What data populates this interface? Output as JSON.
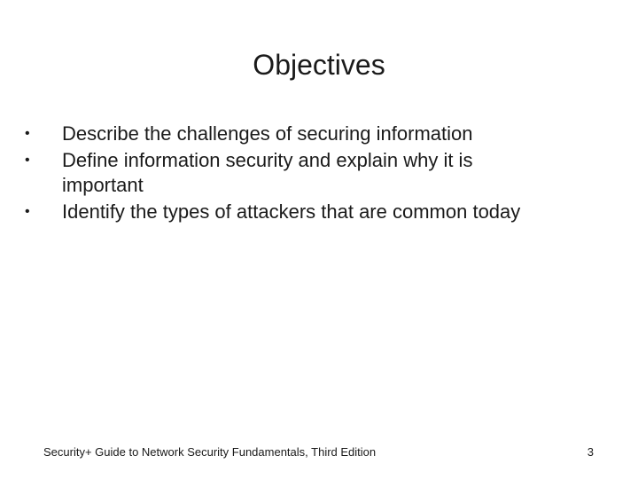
{
  "slide": {
    "title": "Objectives",
    "bullets": [
      "Describe the challenges of securing information",
      "Define information security and explain why it is important",
      "Identify the types of attackers that are common today"
    ],
    "bullet_glyph": "•",
    "footer": "Security+ Guide to Network Security Fundamentals, Third Edition",
    "page_number": "3"
  }
}
